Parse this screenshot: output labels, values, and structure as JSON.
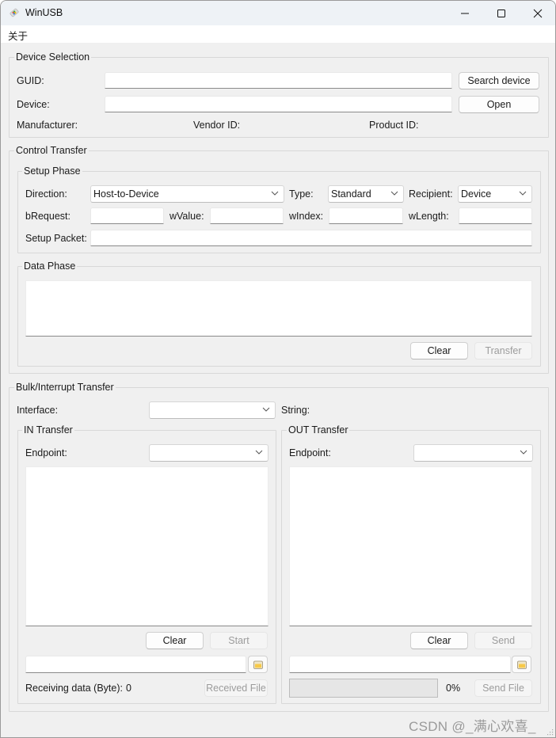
{
  "window": {
    "title": "WinUSB",
    "controls": {
      "minimize": "minimize",
      "maximize": "maximize",
      "close": "close"
    }
  },
  "menu": {
    "items": [
      {
        "label": "关于"
      }
    ]
  },
  "device_selection": {
    "title": "Device Selection",
    "guid_label": "GUID:",
    "guid_value": "",
    "device_label": "Device:",
    "device_value": "",
    "search_button": "Search device",
    "open_button": "Open",
    "manufacturer_label": "Manufacturer:",
    "vendor_id_label": "Vendor ID:",
    "product_id_label": "Product ID:"
  },
  "control_transfer": {
    "title": "Control Transfer",
    "setup_phase": {
      "title": "Setup Phase",
      "direction_label": "Direction:",
      "direction_value": "Host-to-Device",
      "type_label": "Type:",
      "type_value": "Standard",
      "recipient_label": "Recipient:",
      "recipient_value": "Device",
      "brequest_label": "bRequest:",
      "brequest_value": "",
      "wvalue_label": "wValue:",
      "wvalue_value": "",
      "windex_label": "wIndex:",
      "windex_value": "",
      "wlength_label": "wLength:",
      "wlength_value": "",
      "setup_packet_label": "Setup Packet:",
      "setup_packet_value": ""
    },
    "data_phase": {
      "title": "Data Phase",
      "content": "",
      "clear_button": "Clear",
      "transfer_button": "Transfer"
    }
  },
  "bulk_transfer": {
    "title": "Bulk/Interrupt Transfer",
    "interface_label": "Interface:",
    "interface_value": "",
    "string_label": "String:",
    "in_transfer": {
      "title": "IN Transfer",
      "endpoint_label": "Endpoint:",
      "endpoint_value": "",
      "content": "",
      "clear_button": "Clear",
      "start_button": "Start",
      "file_path": "",
      "receiving_label": "Receiving data (Byte):",
      "receiving_value": "0",
      "received_file_button": "Received File"
    },
    "out_transfer": {
      "title": "OUT Transfer",
      "endpoint_label": "Endpoint:",
      "endpoint_value": "",
      "content": "",
      "clear_button": "Clear",
      "send_button": "Send",
      "file_path": "",
      "progress_percent": 0,
      "progress_text": "0%",
      "send_file_button": "Send File"
    }
  },
  "watermark": "CSDN @_满心欢喜_"
}
